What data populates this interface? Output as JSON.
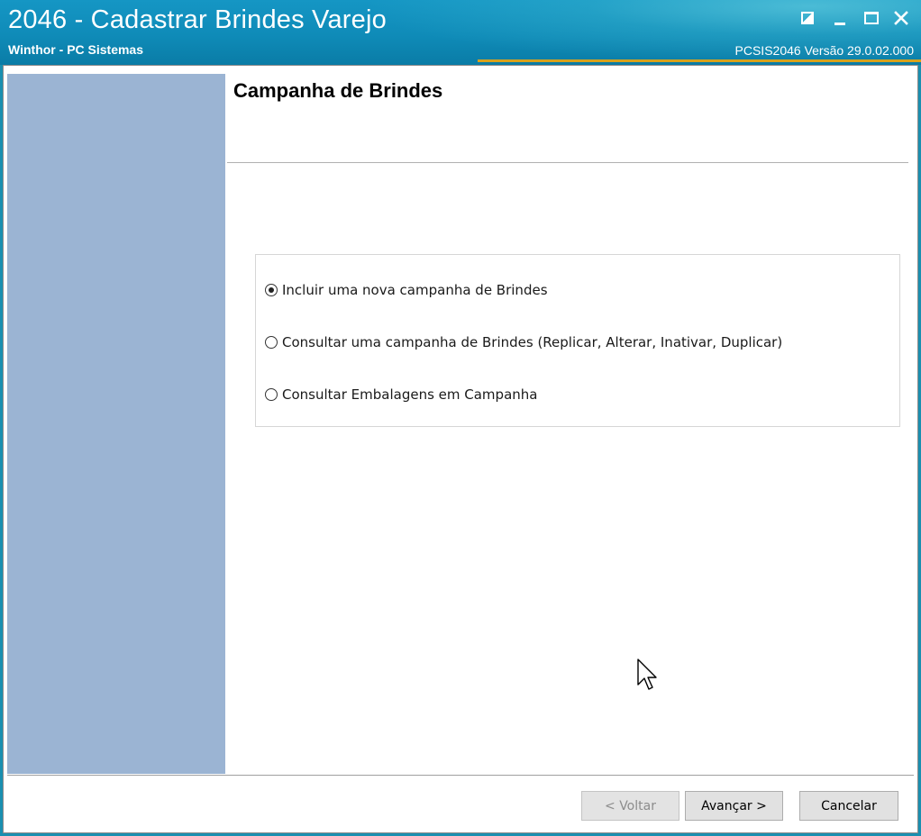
{
  "window": {
    "title": "2046 - Cadastrar Brindes Varejo",
    "subtitle": "Winthor - PC Sistemas",
    "version_text": "PCSIS2046  Versão  29.0.02.000"
  },
  "page": {
    "header_title": "Campanha de Brindes"
  },
  "options": [
    {
      "label": "Incluir uma nova campanha de Brindes",
      "selected": true
    },
    {
      "label": "Consultar uma campanha de Brindes (Replicar, Alterar, Inativar, Duplicar)",
      "selected": false
    },
    {
      "label": "Consultar Embalagens em Campanha",
      "selected": false
    }
  ],
  "buttons": {
    "back": "< Voltar",
    "next": "Avançar >",
    "cancel": "Cancelar"
  },
  "colors": {
    "titlebar": "#0f8bb8",
    "left_panel": "#9bb4d3",
    "accent_line": "#d9a21c"
  }
}
